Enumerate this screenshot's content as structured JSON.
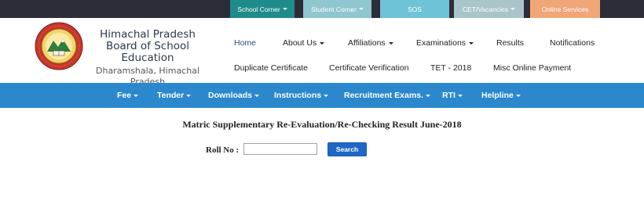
{
  "top_tabs": [
    {
      "label": "School Corner",
      "color": "#1f8b8b",
      "has_caret": true
    },
    {
      "label": "Student Corner",
      "color": "#8fc6cf",
      "has_caret": true
    },
    {
      "label": "SOS",
      "color": "#6ec3d6",
      "has_caret": false
    },
    {
      "label": "CET/Vacancies",
      "color": "#a9c5c9",
      "has_caret": true
    },
    {
      "label": "Online Services",
      "color": "#f1a678",
      "has_caret": false
    }
  ],
  "brand": {
    "line1": "Himachal Pradesh",
    "line2": "Board of School Education",
    "line3": "Dharamshala, Himachal Pradesh",
    "logo_top_text": "BOARD OF SCHOOL EDUCATION",
    "logo_bottom_text": "HIMACHAL PRADESH"
  },
  "nav_row1": [
    {
      "label": "Home",
      "active": true,
      "has_caret": false
    },
    {
      "label": "About Us",
      "has_caret": true
    },
    {
      "label": "Affiliations",
      "has_caret": true
    },
    {
      "label": "Examinations",
      "has_caret": true
    },
    {
      "label": "Results",
      "has_caret": false
    },
    {
      "label": "Notifications",
      "has_caret": false
    }
  ],
  "nav_row2": [
    {
      "label": "Duplicate Certificate"
    },
    {
      "label": "Certificate Verification"
    },
    {
      "label": "TET - 2018"
    },
    {
      "label": "Misc Online Payment"
    }
  ],
  "blue_menu": [
    {
      "label": "Fee"
    },
    {
      "label": "Tender"
    },
    {
      "label": "Downloads"
    },
    {
      "label": "Instructions"
    },
    {
      "label": "Recruitment Exams."
    },
    {
      "label": "RTI"
    },
    {
      "label": "Helpline"
    }
  ],
  "main": {
    "title": "Matric Supplementary Re-Evaluation/Re-Checking Result June-2018",
    "roll_label": "Roll No :",
    "roll_value": "",
    "search_label": "Search"
  },
  "colors": {
    "top_strip": "#2d2d3a",
    "blue_menu": "#2b88cc",
    "search_button": "#1f67c4"
  }
}
